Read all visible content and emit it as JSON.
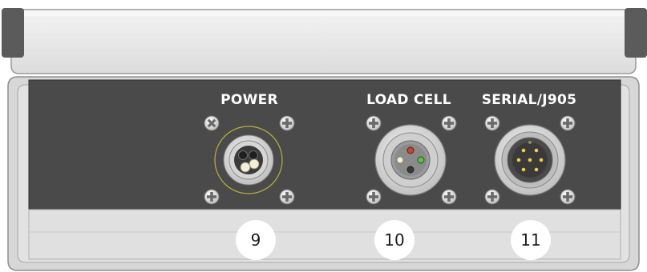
{
  "panel": {
    "connectors": [
      {
        "label": "POWER",
        "number": "9"
      },
      {
        "label": "LOAD CELL",
        "number": "10"
      },
      {
        "label": "SERIAL/J905",
        "number": "11"
      }
    ]
  },
  "colors": {
    "panel_dark": "#4a4a4a",
    "housing_light": "#e8e8e8",
    "label_text": "#ffffff",
    "pin_red": "#c8452c",
    "pin_green": "#5cc24a",
    "pin_yellow": "#f2cc3c",
    "pin_cream": "#f4efd6"
  },
  "icons": [
    "screw-icon",
    "power-connector-icon",
    "load-cell-connector-icon",
    "serial-connector-icon"
  ]
}
